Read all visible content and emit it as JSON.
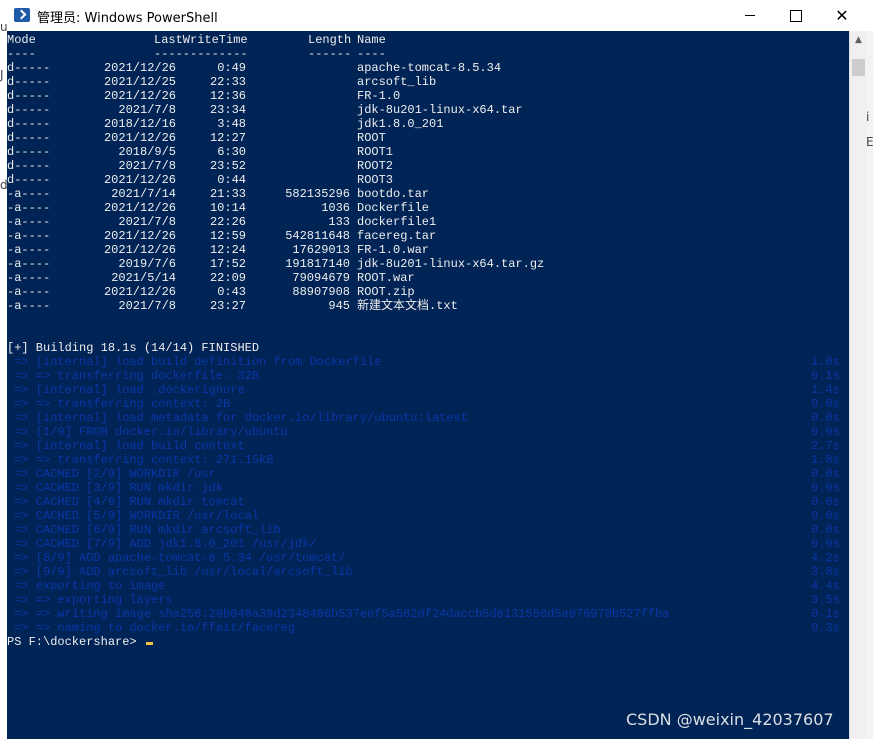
{
  "window": {
    "title": "管理员: Windows PowerShell",
    "minimize": "—",
    "maximize": "☐",
    "close": "✕"
  },
  "console": {
    "header": {
      "mode": "Mode",
      "mode_underline": "----",
      "lastwrite": "LastWriteTime",
      "lastwrite_underline": "-------------",
      "length": "Length",
      "length_underline": "------",
      "name": "Name",
      "name_underline": "----"
    },
    "files": [
      {
        "mode": "d-----",
        "date": "2021/12/26",
        "time": "0:49",
        "length": "",
        "name": "apache-tomcat-8.5.34"
      },
      {
        "mode": "d-----",
        "date": "2021/12/25",
        "time": "22:33",
        "length": "",
        "name": "arcsoft_lib"
      },
      {
        "mode": "d-----",
        "date": "2021/12/26",
        "time": "12:36",
        "length": "",
        "name": "FR-1.0"
      },
      {
        "mode": "d-----",
        "date": "2021/7/8",
        "time": "23:34",
        "length": "",
        "name": "jdk-8u201-linux-x64.tar"
      },
      {
        "mode": "d-----",
        "date": "2018/12/16",
        "time": "3:48",
        "length": "",
        "name": "jdk1.8.0_201"
      },
      {
        "mode": "d-----",
        "date": "2021/12/26",
        "time": "12:27",
        "length": "",
        "name": "ROOT"
      },
      {
        "mode": "d-----",
        "date": "2018/9/5",
        "time": "6:30",
        "length": "",
        "name": "ROOT1"
      },
      {
        "mode": "d-----",
        "date": "2021/7/8",
        "time": "23:52",
        "length": "",
        "name": "ROOT2"
      },
      {
        "mode": "d-----",
        "date": "2021/12/26",
        "time": "0:44",
        "length": "",
        "name": "ROOT3"
      },
      {
        "mode": "-a----",
        "date": "2021/7/14",
        "time": "21:33",
        "length": "582135296",
        "name": "bootdo.tar"
      },
      {
        "mode": "-a----",
        "date": "2021/12/26",
        "time": "10:14",
        "length": "1036",
        "name": "Dockerfile"
      },
      {
        "mode": "-a----",
        "date": "2021/7/8",
        "time": "22:26",
        "length": "133",
        "name": "dockerfile1"
      },
      {
        "mode": "-a----",
        "date": "2021/12/26",
        "time": "12:59",
        "length": "542811648",
        "name": "facereg.tar"
      },
      {
        "mode": "-a----",
        "date": "2021/12/26",
        "time": "12:24",
        "length": "17629013",
        "name": "FR-1.0.war"
      },
      {
        "mode": "-a----",
        "date": "2019/7/6",
        "time": "17:52",
        "length": "191817140",
        "name": "jdk-8u201-linux-x64.tar.gz"
      },
      {
        "mode": "-a----",
        "date": "2021/5/14",
        "time": "22:09",
        "length": "79094679",
        "name": "ROOT.war"
      },
      {
        "mode": "-a----",
        "date": "2021/12/26",
        "time": "0:43",
        "length": "88907908",
        "name": "ROOT.zip"
      },
      {
        "mode": "-a----",
        "date": "2021/7/8",
        "time": "23:27",
        "length": "945",
        "name": "新建文本文档.txt"
      }
    ],
    "build_header": "[+] Building 18.1s (14/14) FINISHED",
    "build_lines": [
      {
        "text": " => [internal] load build definition from Dockerfile",
        "dur": "1.0s"
      },
      {
        "text": " => => transferring dockerfile: 32B",
        "dur": "0.1s"
      },
      {
        "text": " => [internal] load .dockerignore",
        "dur": "1.4s"
      },
      {
        "text": " => => transferring context: 2B",
        "dur": "0.0s"
      },
      {
        "text": " => [internal] load metadata for docker.io/library/ubuntu:latest",
        "dur": "0.0s"
      },
      {
        "text": " => [1/9] FROM docker.io/library/ubuntu",
        "dur": "0.0s"
      },
      {
        "text": " => [internal] load build context",
        "dur": "2.7s"
      },
      {
        "text": " => => transferring context: 271.15kB",
        "dur": "1.8s"
      },
      {
        "text": " => CACHED [2/9] WORKDIR /usr",
        "dur": "0.0s"
      },
      {
        "text": " => CACHED [3/9] RUN mkdir jdk",
        "dur": "0.0s"
      },
      {
        "text": " => CACHED [4/9] RUN mkdir tomcat",
        "dur": "0.0s"
      },
      {
        "text": " => CACHED [5/9] WORKDIR /usr/local",
        "dur": "0.0s"
      },
      {
        "text": " => CACHED [6/9] RUN mkdir arcsoft_lib",
        "dur": "0.0s"
      },
      {
        "text": " => CACHED [7/9] ADD jdk1.8.0_201 /usr/jdk/",
        "dur": "0.0s"
      },
      {
        "text": " => [8/9] ADD apache-tomcat-8.5.34 /usr/tomcat/",
        "dur": "4.2s"
      },
      {
        "text": " => [9/9] ADD arcsoft_lib /usr/local/arcsoft_lib",
        "dur": "3.8s"
      },
      {
        "text": " => exporting to image",
        "dur": "4.4s"
      },
      {
        "text": " => => exporting layers",
        "dur": "3.5s"
      },
      {
        "text": " => => writing image sha256:29b048a39d2348486b537eef5a5820f24daccb5d8131550d5a076970b527ffba",
        "dur": "0.1s"
      },
      {
        "text": " => => naming to docker.io/ffait/facereg",
        "dur": "0.3s"
      }
    ],
    "prompt": "PS F:\\dockershare> "
  },
  "watermark": "CSDN @weixin_42037607",
  "background_glyphs": [
    "u",
    "J",
    "i",
    "d",
    "E"
  ],
  "colors": {
    "console_bg": "#012456",
    "console_fg": "#eeeeee",
    "dim_fg": "#0a36a8",
    "cursor": "#f5c542"
  }
}
